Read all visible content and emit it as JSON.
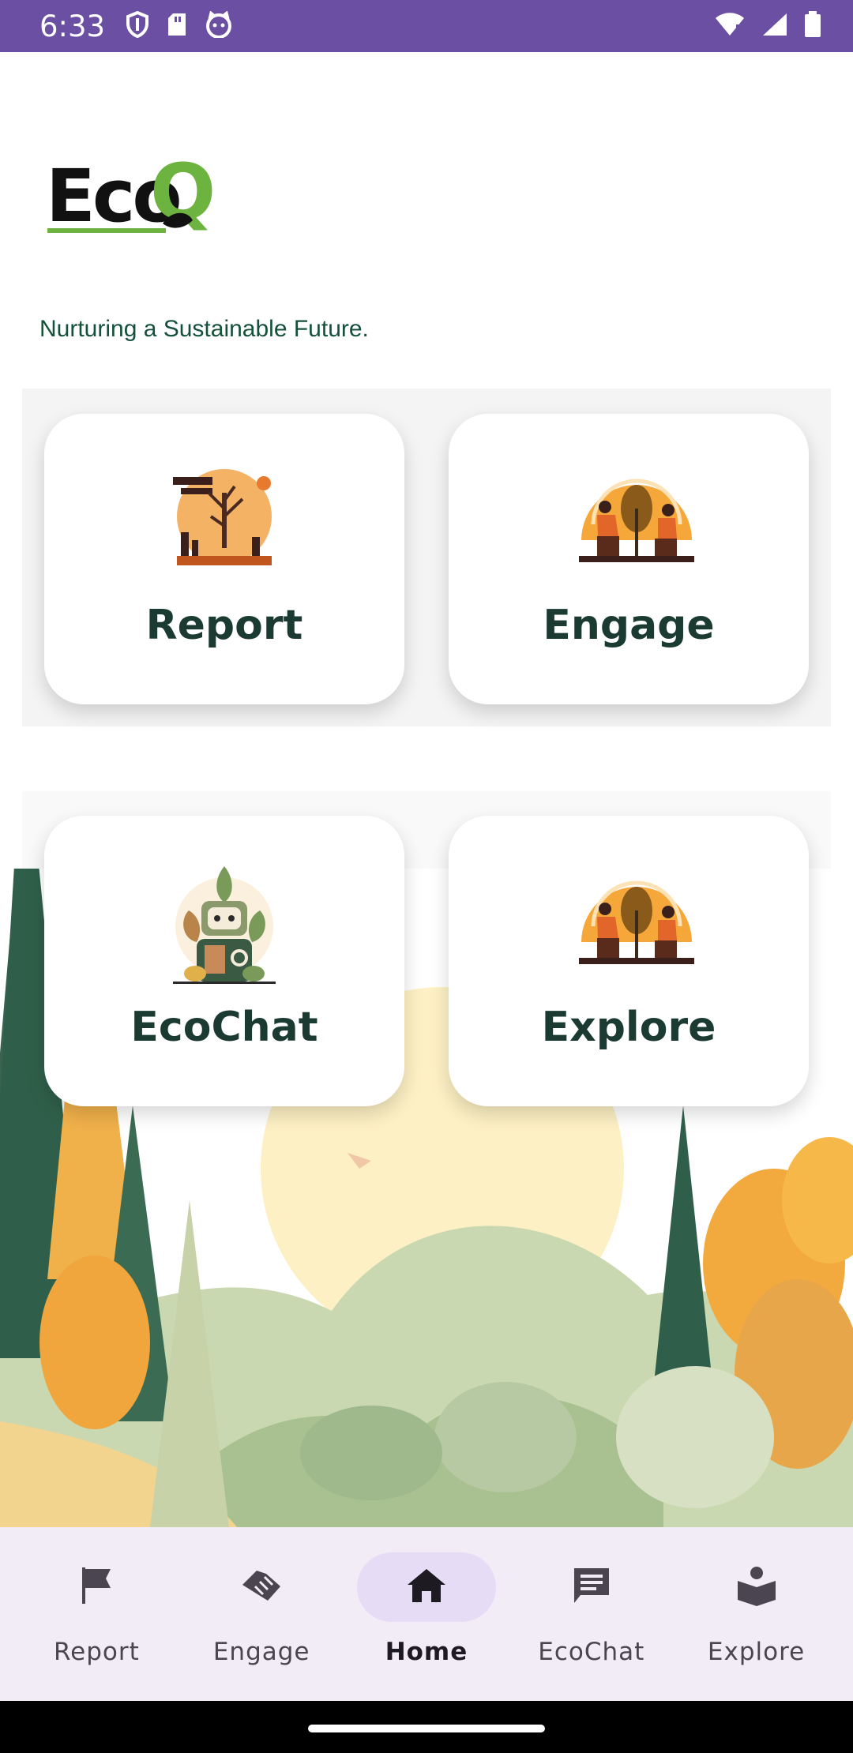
{
  "status_bar": {
    "time": "6:33",
    "left_icons": [
      "shield-icon",
      "sd-card-icon",
      "cat-icon"
    ],
    "right_icons": [
      "wifi-icon",
      "signal-icon",
      "battery-icon"
    ],
    "color": "#6a4fa3"
  },
  "brand": {
    "logo_text_eco": "Eco",
    "logo_text_q": "Q",
    "tagline": "Nurturing a Sustainable Future."
  },
  "cards": [
    {
      "label": "Report",
      "icon": "polluted-tree-illustration"
    },
    {
      "label": "Engage",
      "icon": "people-planting-tree-illustration"
    },
    {
      "label": "EcoChat",
      "icon": "plant-robot-illustration"
    },
    {
      "label": "Explore",
      "icon": "people-planting-tree-illustration"
    }
  ],
  "bottom_nav": {
    "items": [
      {
        "label": "Report",
        "icon": "flag-icon"
      },
      {
        "label": "Engage",
        "icon": "handshake-icon"
      },
      {
        "label": "Home",
        "icon": "home-icon",
        "selected": true
      },
      {
        "label": "EcoChat",
        "icon": "chat-icon"
      },
      {
        "label": "Explore",
        "icon": "book-person-icon"
      }
    ]
  },
  "colors": {
    "accent_green": "#6db33f",
    "card_text": "#1b3a32",
    "nav_bg": "#f1ecf6",
    "nav_active_pill": "#e6dcf6"
  }
}
